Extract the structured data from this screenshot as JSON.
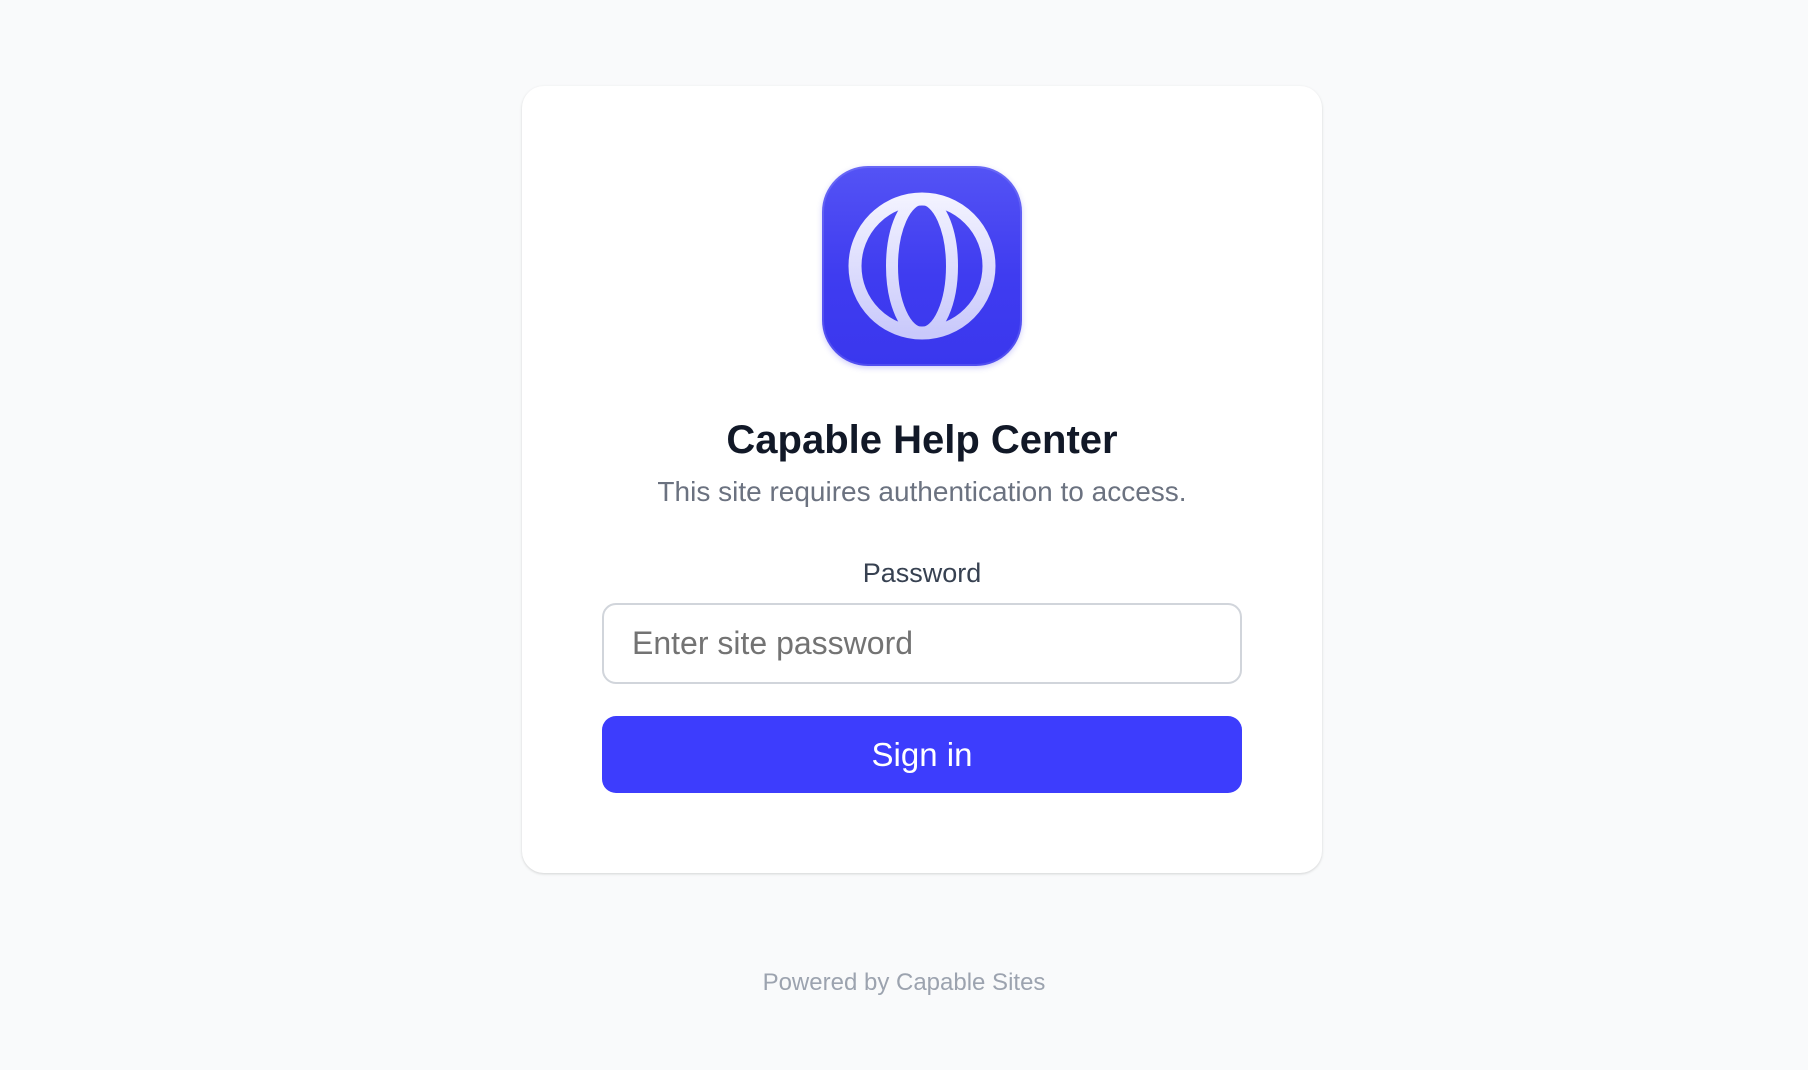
{
  "site": {
    "icon": "globe-icon",
    "title": "Capable Help Center",
    "subtitle": "This site requires authentication to access."
  },
  "form": {
    "password_label": "Password",
    "password_placeholder": "Enter site password",
    "password_value": "",
    "submit_label": "Sign in"
  },
  "footer": {
    "text": "Powered by Capable Sites"
  },
  "colors": {
    "accent": "#3d3dfd",
    "background": "#f9fafb",
    "card": "#ffffff"
  }
}
